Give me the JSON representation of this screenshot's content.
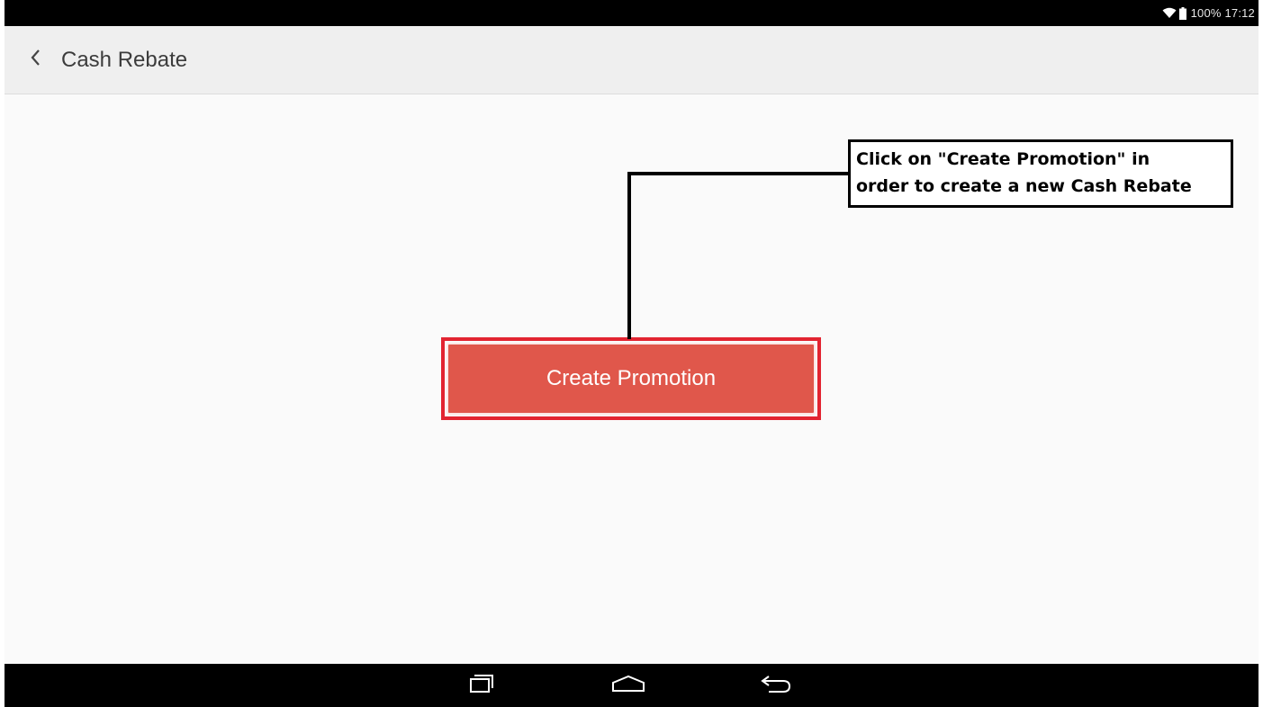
{
  "status_bar": {
    "icons": [
      "wifi-icon",
      "battery-icon"
    ],
    "text": "100% 17:12"
  },
  "app_bar": {
    "back_icon": "chevron-left-icon",
    "title": "Cash Rebate"
  },
  "main": {
    "create_button_label": "Create Promotion",
    "button_color": "#e0574b",
    "highlight_color": "#e22431"
  },
  "annotation": {
    "line1": "Click on \"Create Promotion\" in",
    "line2": "order to create a new Cash Rebate"
  },
  "nav_bar": {
    "buttons": [
      "recent-apps-icon",
      "home-icon",
      "back-icon"
    ]
  }
}
